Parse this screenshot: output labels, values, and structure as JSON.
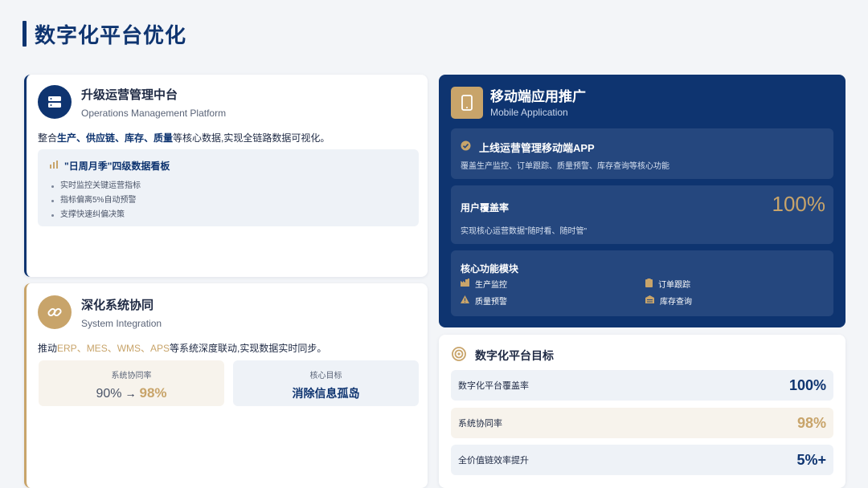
{
  "page": {
    "title": "数字化平台优化"
  },
  "ops": {
    "title": "升级运营管理中台",
    "subtitle": "Operations Management Platform",
    "desc_parts": [
      "整合",
      "生产、供应链、库存、质量",
      "等核心数据,实现全链路数据可视化。"
    ],
    "board": {
      "title": "\"日周月季\"四级数据看板",
      "bullets": [
        "实时监控关键运营指标",
        "指标偏离5%自动预警",
        "支撑快速纠偏决策"
      ]
    }
  },
  "integration": {
    "title": "深化系统协同",
    "subtitle": "System Integration",
    "desc_parts": [
      "推动",
      "ERP、MES、WMS、APS",
      "等系统深度联动,实现数据实时同步。"
    ],
    "rate": {
      "label": "系统协同率",
      "from": "90%",
      "arrow": "→",
      "to": "98%"
    },
    "goal": {
      "label": "核心目标",
      "value": "消除信息孤岛"
    }
  },
  "mobile": {
    "title": "移动端应用推广",
    "subtitle": "Mobile Application",
    "launch": {
      "title": "上线运营管理移动端APP",
      "text": "覆盖生产监控、订单跟踪、质量预警、库存查询等核心功能"
    },
    "coverage": {
      "title": "用户覆盖率",
      "value": "100%",
      "text": "实现核心运营数据\"随时看、随时管\""
    },
    "modules": {
      "title": "核心功能模块",
      "items": [
        {
          "label": "生产监控",
          "icon": "factory-icon"
        },
        {
          "label": "订单跟踪",
          "icon": "clipboard-icon"
        },
        {
          "label": "质量预警",
          "icon": "warning-icon"
        },
        {
          "label": "库存查询",
          "icon": "warehouse-icon"
        }
      ]
    }
  },
  "goals": {
    "title": "数字化平台目标",
    "rows": [
      {
        "label": "数字化平台覆盖率",
        "value": "100%"
      },
      {
        "label": "系统协同率",
        "value": "98%"
      },
      {
        "label": "全价值链效率提升",
        "value": "5%+"
      }
    ]
  },
  "colors": {
    "navy": "#0e3470",
    "gold": "#c8a46a",
    "panel": "#25477e"
  }
}
